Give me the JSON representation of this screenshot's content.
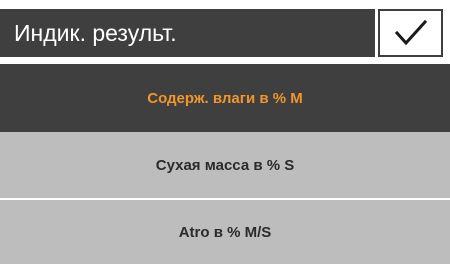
{
  "header": {
    "title": "Индик. результ.",
    "confirm_icon": "checkmark-icon"
  },
  "options": [
    {
      "label": "Содерж. влаги в % M",
      "selected": true
    },
    {
      "label": "Сухая масса в % S",
      "selected": false
    },
    {
      "label": "Atro в % M/S",
      "selected": false
    }
  ],
  "colors": {
    "header_bg": "#3f3f3f",
    "selected_bg": "#3f3f3f",
    "selected_text": "#f0962a",
    "option_bg": "#bdbdbd",
    "option_text": "#2b2b2b"
  }
}
